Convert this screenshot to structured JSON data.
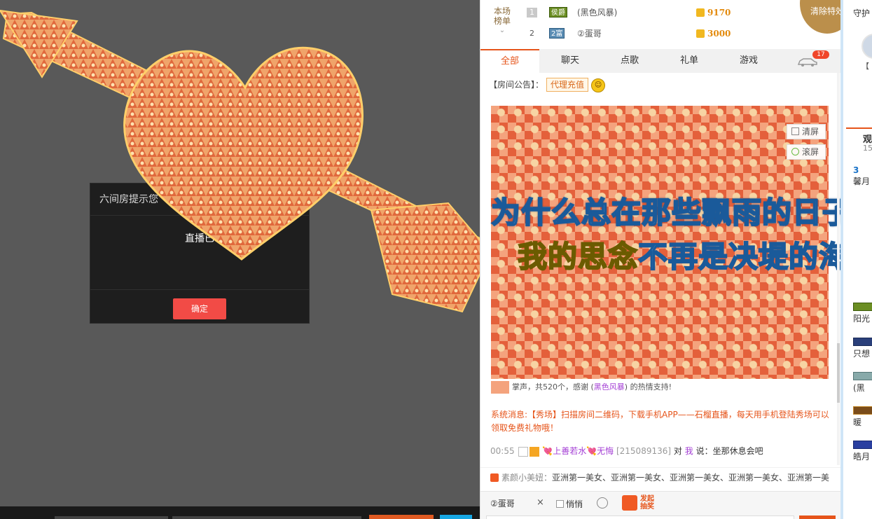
{
  "dialog": {
    "title": "六间房提示您",
    "message": "直播已",
    "ok_label": "确定"
  },
  "rank": {
    "label": "本场榜单",
    "rows": [
      {
        "num": "1",
        "badge": "侯爵",
        "name": "(黑色风暴)",
        "amount": "9170"
      },
      {
        "num": "2",
        "badge": "2富",
        "name": "②蛋哥",
        "amount": "3000"
      }
    ]
  },
  "clear_effect_label": "清除特效",
  "tabs": [
    "全部",
    "聊天",
    "点歌",
    "礼单",
    "游戏"
  ],
  "car_badge": "17",
  "announce": {
    "label": "【房间公告】：",
    "link": "代理充值"
  },
  "wall": {
    "clear_label": "清屏",
    "scroll_label": "滚屏"
  },
  "lyrics": {
    "line1": "为什么总在那些飘雨的日子",
    "line2_a": "我的思念",
    "line2_b": "不再是决堤的海"
  },
  "applause": {
    "pre": "掌声，共520个，感谢 (",
    "name": "黑色风暴",
    "post": ") 的热情支持!"
  },
  "system_message": "系统消息:【秀场】扫描房间二维码，下载手机APP——石榴直播，每天用手机登陆秀场可以领取免费礼物哦！",
  "chat": {
    "time": "00:55",
    "nick": "💘上善若水💘无悔",
    "uid": "[215089136]",
    "to": "对",
    "me": "我",
    "say": "说：",
    "text": "坐那休息会吧"
  },
  "broadcast": {
    "who": "素颜小美妞：",
    "text": "亚洲第一美女、亚洲第一美女、亚洲第一美女、亚洲第一美女、亚洲第一美"
  },
  "input": {
    "target": "②蛋哥",
    "close": "×",
    "whisper": "悄悄",
    "lottery": "发起抽奖"
  },
  "side": {
    "guard": "守护",
    "small": "【",
    "view": "观",
    "count": "15",
    "items": [
      {
        "badge": "3",
        "text": "馨月"
      },
      {
        "badge": "",
        "text": "阳光"
      },
      {
        "badge": "",
        "text": "只想"
      },
      {
        "badge": "",
        "text": "(黑"
      },
      {
        "badge": "",
        "text": "暖"
      },
      {
        "badge": "",
        "text": "皓月"
      }
    ]
  },
  "colors": {
    "accent": "#e6541a",
    "dialog_ok": "#f24b46",
    "coin": "#e38a0c",
    "clear_effect": "#bb8f4b"
  }
}
